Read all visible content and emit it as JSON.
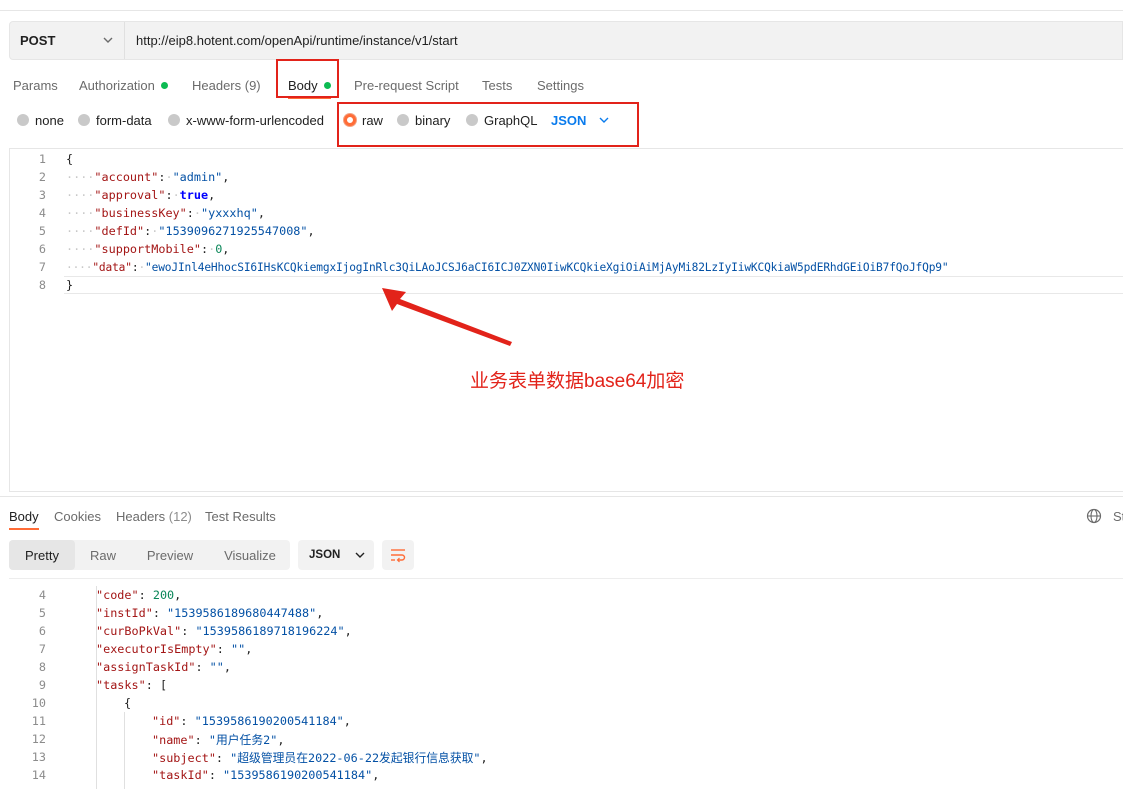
{
  "request": {
    "method": "POST",
    "url": "http://eip8.hotent.com/openApi/runtime/instance/v1/start",
    "tabs": [
      {
        "label": "Params",
        "dot": false
      },
      {
        "label": "Authorization",
        "dot": true
      },
      {
        "label": "Headers (9)",
        "dot": false
      },
      {
        "label": "Body",
        "dot": true
      },
      {
        "label": "Pre-request Script",
        "dot": false
      },
      {
        "label": "Tests",
        "dot": false
      },
      {
        "label": "Settings",
        "dot": false
      }
    ],
    "active_tab": "Body",
    "body_types": [
      "none",
      "form-data",
      "x-www-form-urlencoded",
      "raw",
      "binary",
      "GraphQL"
    ],
    "selected_body_type": "raw",
    "raw_format": "JSON"
  },
  "editor": {
    "line_numbers": [
      "1",
      "2",
      "3",
      "4",
      "5",
      "6",
      "7",
      "8"
    ],
    "open_brace": "{",
    "close_brace": "}",
    "fields": [
      {
        "key": "\"account\"",
        "value": "\"admin\"",
        "kind": "str"
      },
      {
        "key": "\"approval\"",
        "value": "true",
        "kind": "kw"
      },
      {
        "key": "\"businessKey\"",
        "value": "\"yxxxhq\"",
        "kind": "str"
      },
      {
        "key": "\"defId\"",
        "value": "\"1539096271925547008\"",
        "kind": "str"
      },
      {
        "key": "\"supportMobile\"",
        "value": "0",
        "kind": "num"
      },
      {
        "key": "\"data\"",
        "value": "\"ewoJInl4eHhocSI6IHsKCQkiemgxIjogInRlc3QiLAoJCSJ6aCI6ICJ0ZXN0IiwKCQkieXgiOiAiMjAyMi82LzIyIiwKCQkiaW5pdERhdGEiOiB7fQoJfQp9\"",
        "kind": "str"
      }
    ]
  },
  "annotation": "业务表单数据base64加密",
  "response": {
    "tabs": [
      {
        "label": "Body",
        "count": ""
      },
      {
        "label": "Cookies",
        "count": ""
      },
      {
        "label": "Headers",
        "count": "(12)"
      },
      {
        "label": "Test Results",
        "count": ""
      }
    ],
    "view_modes": [
      "Pretty",
      "Raw",
      "Preview",
      "Visualize"
    ],
    "active_view": "Pretty",
    "format": "JSON",
    "corner_text": "St",
    "lines": [
      {
        "n": "4",
        "indent": 1,
        "key": "\"code\"",
        "value": "200",
        "kind": "num",
        "trail": ","
      },
      {
        "n": "5",
        "indent": 1,
        "key": "\"instId\"",
        "value": "\"1539586189680447488\"",
        "kind": "str",
        "trail": ","
      },
      {
        "n": "6",
        "indent": 1,
        "key": "\"curBoPkVal\"",
        "value": "\"1539586189718196224\"",
        "kind": "str",
        "trail": ","
      },
      {
        "n": "7",
        "indent": 1,
        "key": "\"executorIsEmpty\"",
        "value": "\"\"",
        "kind": "str",
        "trail": ","
      },
      {
        "n": "8",
        "indent": 1,
        "key": "\"assignTaskId\"",
        "value": "\"\"",
        "kind": "str",
        "trail": ","
      },
      {
        "n": "9",
        "indent": 1,
        "key": "\"tasks\"",
        "value": "[",
        "kind": "punc",
        "trail": ""
      },
      {
        "n": "10",
        "indent": 2,
        "key": "",
        "value": "{",
        "kind": "punc",
        "trail": ""
      },
      {
        "n": "11",
        "indent": 3,
        "key": "\"id\"",
        "value": "\"1539586190200541184\"",
        "kind": "str",
        "trail": ","
      },
      {
        "n": "12",
        "indent": 3,
        "key": "\"name\"",
        "value": "\"用户任务2\"",
        "kind": "str",
        "trail": ","
      },
      {
        "n": "13",
        "indent": 3,
        "key": "\"subject\"",
        "value": "\"超级管理员在2022-06-22发起银行信息获取\"",
        "kind": "str",
        "trail": ","
      },
      {
        "n": "14",
        "indent": 3,
        "key": "\"taskId\"",
        "value": "\"1539586190200541184\"",
        "kind": "str",
        "trail": ","
      }
    ]
  },
  "colors": {
    "accent": "#ff6c37",
    "dot_green": "#0cbb52",
    "highlight_red": "#e2231a",
    "json_blue": "#097bed"
  }
}
